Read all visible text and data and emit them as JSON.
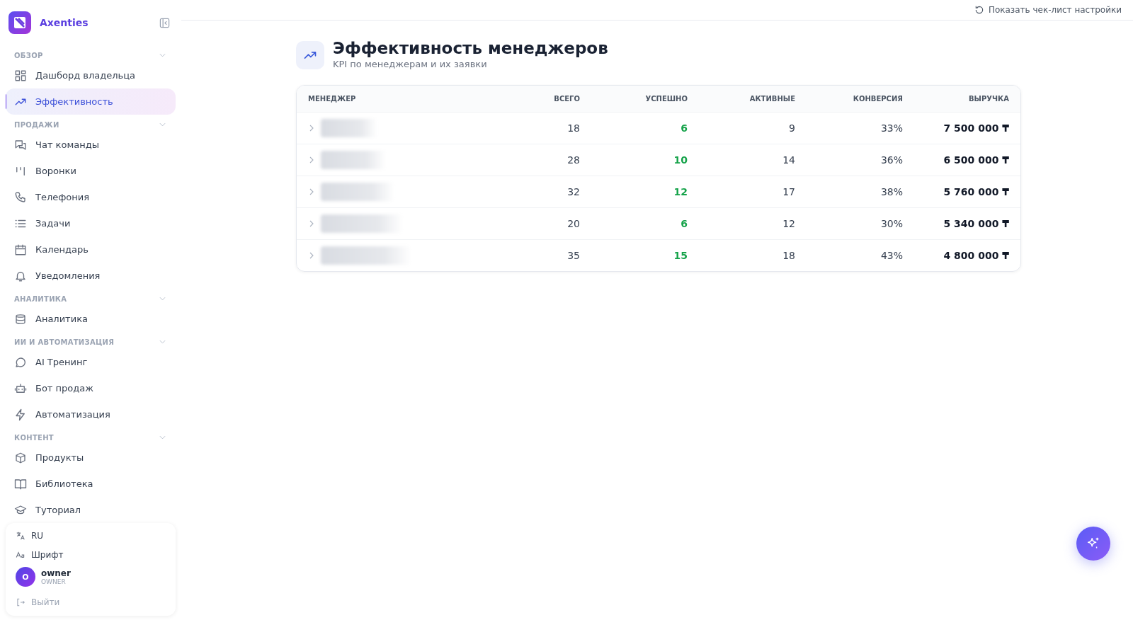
{
  "brand": {
    "name": "Axenties"
  },
  "sidebar": {
    "sections": [
      {
        "label": "ОБЗОР",
        "expanded": true,
        "items": [
          {
            "label": "Дашборд владельца",
            "selected": false
          },
          {
            "label": "Эффективность",
            "selected": true
          }
        ]
      },
      {
        "label": "ПРОДАЖИ",
        "expanded": true,
        "items": [
          {
            "label": "Чат команды",
            "selected": false
          },
          {
            "label": "Воронки",
            "selected": false
          },
          {
            "label": "Телефония",
            "selected": false
          },
          {
            "label": "Задачи",
            "selected": false
          },
          {
            "label": "Календарь",
            "selected": false
          },
          {
            "label": "Уведомления",
            "selected": false
          }
        ]
      },
      {
        "label": "АНАЛИТИКА",
        "expanded": true,
        "items": [
          {
            "label": "Аналитика",
            "selected": false
          }
        ]
      },
      {
        "label": "ИИ И АВТОМАТИЗАЦИЯ",
        "expanded": true,
        "items": [
          {
            "label": "AI Тренинг",
            "selected": false
          },
          {
            "label": "Бот продаж",
            "selected": false
          },
          {
            "label": "Автоматизация",
            "selected": false
          }
        ]
      },
      {
        "label": "КОНТЕНТ",
        "expanded": true,
        "items": [
          {
            "label": "Продукты",
            "selected": false
          },
          {
            "label": "Библиотека",
            "selected": false
          },
          {
            "label": "Туториал",
            "selected": false
          }
        ]
      }
    ]
  },
  "footer": {
    "language": "RU",
    "font": "Шрифт",
    "user": {
      "avatar": "O",
      "name": "owner",
      "role": "OWNER"
    },
    "logout": "Выйти"
  },
  "topbar": {
    "checklist": "Показать чек-лист настройки"
  },
  "page": {
    "title": "Эффективность менеджеров",
    "subtitle": "KPI по менеджерам и их заявки"
  },
  "table": {
    "columns": [
      "МЕНЕДЖЕР",
      "ВСЕГО",
      "УСПЕШНО",
      "АКТИВНЫЕ",
      "КОНВЕРСИЯ",
      "ВЫРУЧКА"
    ],
    "rows": [
      {
        "total": "18",
        "success": "6",
        "active": "9",
        "conversion": "33%",
        "revenue": "7 500 000 ₸"
      },
      {
        "total": "28",
        "success": "10",
        "active": "14",
        "conversion": "36%",
        "revenue": "6 500 000 ₸"
      },
      {
        "total": "32",
        "success": "12",
        "active": "17",
        "conversion": "38%",
        "revenue": "5 760 000 ₸"
      },
      {
        "total": "20",
        "success": "6",
        "active": "12",
        "conversion": "30%",
        "revenue": "5 340 000 ₸"
      },
      {
        "total": "35",
        "success": "15",
        "active": "18",
        "conversion": "43%",
        "revenue": "4 800 000 ₸"
      }
    ]
  }
}
